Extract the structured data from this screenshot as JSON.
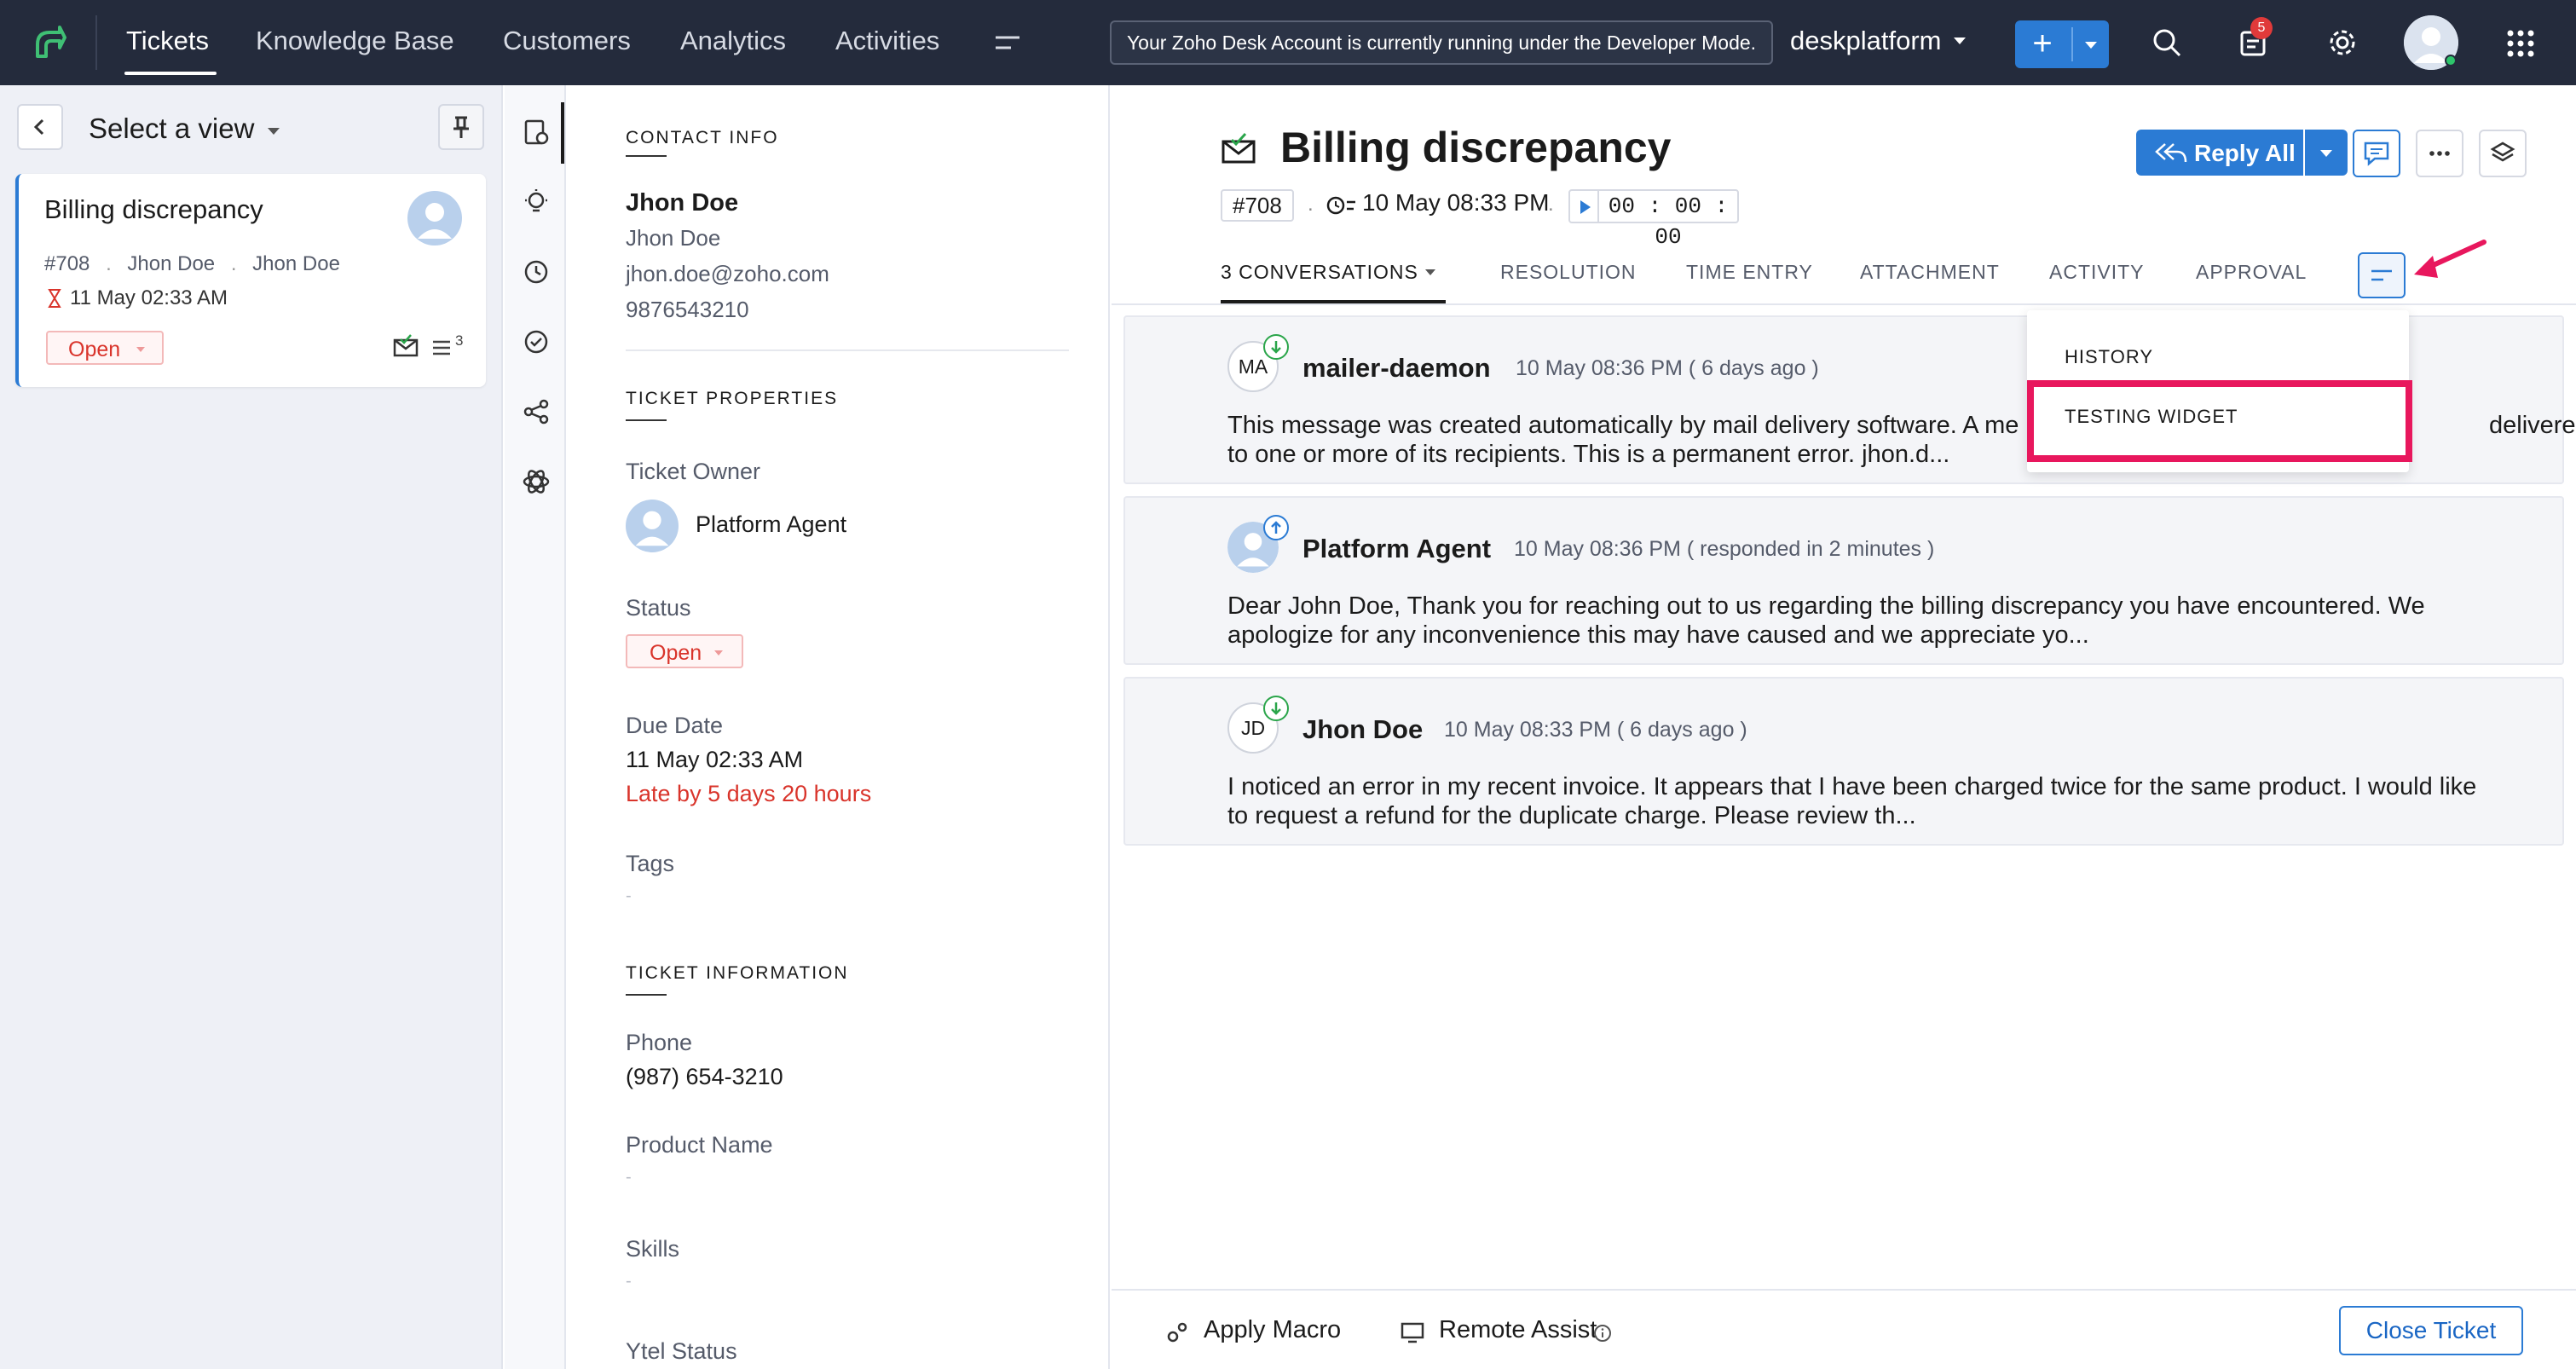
{
  "nav": {
    "tabs": [
      "Tickets",
      "Knowledge Base",
      "Customers",
      "Analytics",
      "Activities"
    ],
    "dev_banner": "Your Zoho Desk Account is currently running under the Developer Mode.",
    "portal": "deskplatform",
    "add_label": "+",
    "notification_count": "5"
  },
  "list": {
    "view_title": "Select a view",
    "card": {
      "title": "Billing discrepancy",
      "id": "#708",
      "contact": "Jhon Doe",
      "account": "Jhon Doe",
      "due": "11 May 02:33 AM",
      "status": "Open",
      "conv_count": "3"
    }
  },
  "props": {
    "contact_head": "CONTACT INFO",
    "contact_name": "Jhon Doe",
    "contact_account": "Jhon Doe",
    "contact_email": "jhon.doe@zoho.com",
    "contact_phone": "9876543210",
    "ticket_props_head": "TICKET PROPERTIES",
    "owner_label": "Ticket Owner",
    "owner_value": "Platform Agent",
    "status_label": "Status",
    "status_value": "Open",
    "due_label": "Due Date",
    "due_value": "11 May 02:33 AM",
    "due_late": "Late by 5 days 20 hours",
    "tags_label": "Tags",
    "tags_value": "-",
    "ticket_info_head": "TICKET INFORMATION",
    "phone_label": "Phone",
    "phone_value": "(987) 654-3210",
    "product_label": "Product Name",
    "product_value": "-",
    "skills_label": "Skills",
    "skills_value": "-",
    "ytel_label": "Ytel Status"
  },
  "ticket": {
    "title": "Billing discrepancy",
    "id": "#708",
    "created": "10 May 08:33 PM",
    "timer": "00 : 00 : 00",
    "reply_all": "Reply All",
    "separator": "."
  },
  "tabs": [
    "3 CONVERSATIONS",
    "RESOLUTION",
    "TIME ENTRY",
    "ATTACHMENT",
    "ACTIVITY",
    "APPROVAL"
  ],
  "conversations": [
    {
      "initials": "MA",
      "name": "mailer-daemon",
      "time": "10 May 08:36 PM ( 6 days ago )",
      "body": "This message was created automatically by mail delivery software. A me",
      "body_tail": "delivered",
      "body_line2": "to one or more of its recipients. This is a permanent error. jhon.d..."
    },
    {
      "initials": "",
      "name": "Platform Agent",
      "time": "10 May 08:36 PM ( responded in 2 minutes )",
      "body": "Dear John Doe, Thank you for reaching out to us regarding the billing discrepancy you have encountered. We",
      "body_line2": "apologize for any inconvenience this may have caused and we appreciate yo..."
    },
    {
      "initials": "JD",
      "name": "Jhon Doe",
      "time": "10 May 08:33 PM ( 6 days ago )",
      "body": "I noticed an error in my recent invoice. It appears that I have been charged twice for the same product. I would like",
      "body_line2": "to request a refund for the duplicate charge. Please review th..."
    }
  ],
  "dropdown": {
    "items": [
      "HISTORY",
      "TESTING WIDGET"
    ]
  },
  "bottom": {
    "apply_macro": "Apply Macro",
    "remote_assist": "Remote Assist",
    "close_ticket": "Close Ticket"
  },
  "colors": {
    "nav_bg": "#242b3c",
    "accent": "#2b7bd4",
    "open_status": "#d9342b",
    "highlight": "#e8175d"
  }
}
